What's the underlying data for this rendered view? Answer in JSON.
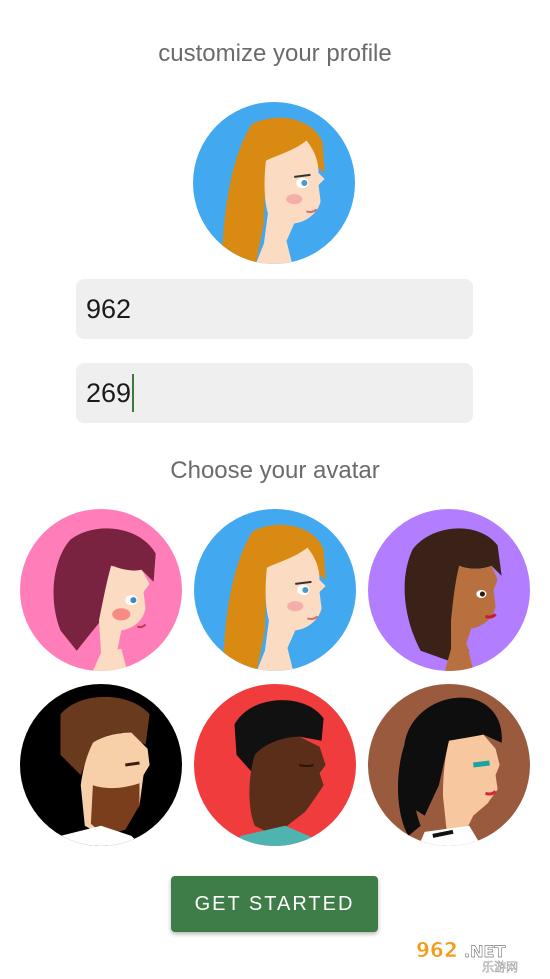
{
  "header": {
    "title": "customize your profile"
  },
  "profile": {
    "selected_avatar": "orange-hair-woman-avatar",
    "first_field_value": "962",
    "second_field_value": "269"
  },
  "avatar_section": {
    "heading": "Choose your avatar",
    "options": [
      {
        "id": "avatar-1",
        "icon": "maroon-hair-woman-avatar",
        "background": "#ff7eb9"
      },
      {
        "id": "avatar-2",
        "icon": "orange-hair-woman-avatar",
        "background": "#42a8f0"
      },
      {
        "id": "avatar-3",
        "icon": "dark-hair-woman-avatar",
        "background": "#b27dff"
      },
      {
        "id": "avatar-4",
        "icon": "bearded-man-avatar",
        "background": "#000000"
      },
      {
        "id": "avatar-5",
        "icon": "dark-skin-man-avatar",
        "background": "#f03c3c"
      },
      {
        "id": "avatar-6",
        "icon": "ponytail-woman-avatar",
        "background": "#9a5a3e"
      }
    ]
  },
  "actions": {
    "get_started_label": "GET STARTED"
  },
  "watermark": {
    "text": "962.NET",
    "subtext": "乐游网"
  },
  "colors": {
    "accent_button": "#3e7d47",
    "field_background": "#efefef",
    "text_gray": "#6b6b6b"
  }
}
